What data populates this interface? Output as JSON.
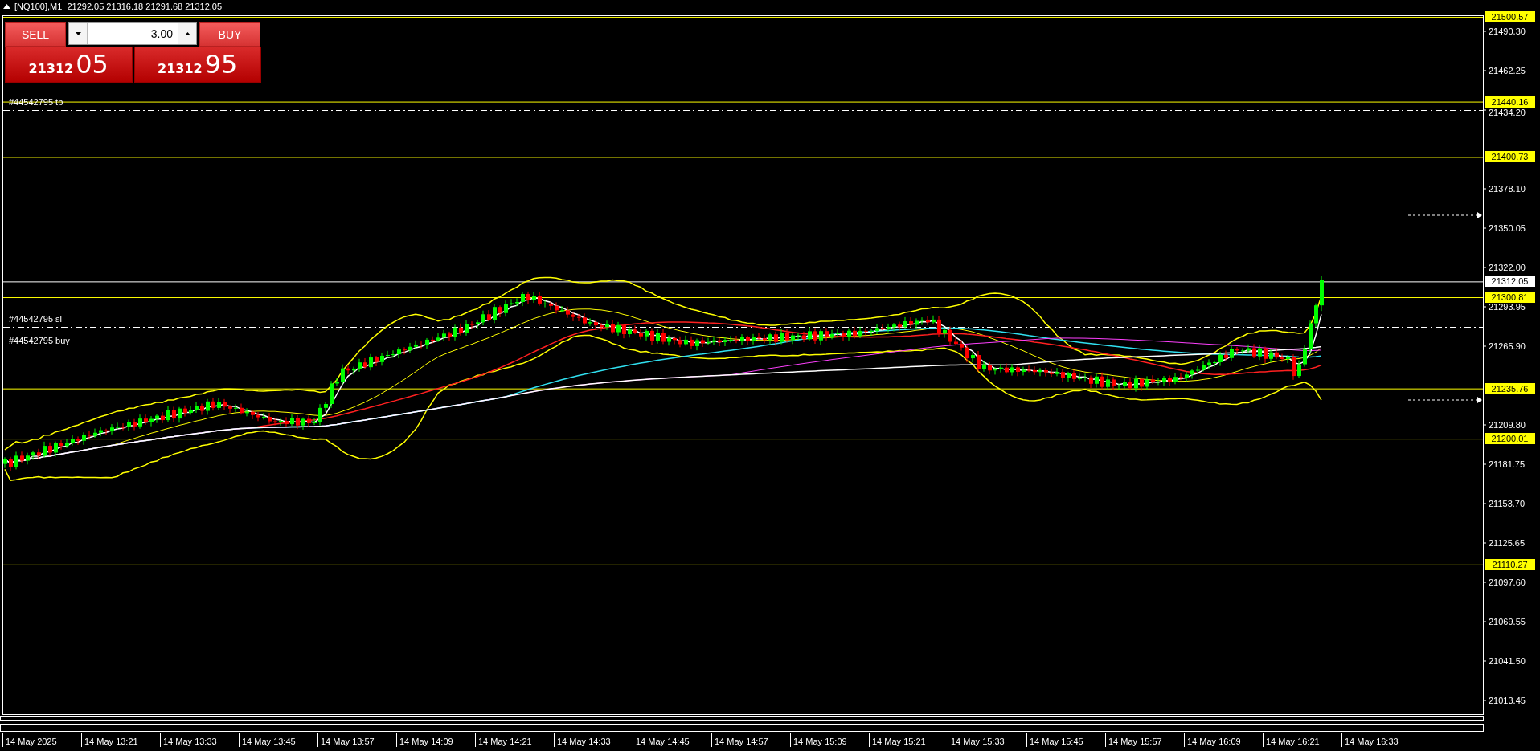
{
  "chart": {
    "title": "[NQ100],M1  21292.05 21316.18 21291.68 21312.05"
  },
  "trade_panel": {
    "sell_label": "SELL",
    "buy_label": "BUY",
    "volume": "3.00",
    "sell_price": {
      "main": "21312",
      "big": "05"
    },
    "buy_price": {
      "main": "21312",
      "big": "95"
    }
  },
  "orders": [
    {
      "label": "#44542795 tp",
      "kind": "tp"
    },
    {
      "label": "#44542795 sl",
      "kind": "sl"
    },
    {
      "label": "#44542795 buy",
      "kind": "buy"
    }
  ],
  "price_levels": [
    {
      "label": "21500.57",
      "kind": "level"
    },
    {
      "label": "21440.16",
      "kind": "level"
    },
    {
      "label": "21400.73",
      "kind": "level"
    },
    {
      "label": "21312.05",
      "kind": "bid"
    },
    {
      "label": "21300.81",
      "kind": "level"
    },
    {
      "label": "21235.76",
      "kind": "level"
    },
    {
      "label": "21200.01",
      "kind": "level"
    },
    {
      "label": "21110.27",
      "kind": "level"
    }
  ],
  "price_axis": {
    "ticks": [
      "21490.30",
      "21462.25",
      "21434.20",
      "21378.10",
      "21350.05",
      "21322.00",
      "21293.95",
      "21265.90",
      "21209.80",
      "21181.75",
      "21153.70",
      "21125.65",
      "21097.60",
      "21069.55",
      "21041.50",
      "21013.45"
    ]
  },
  "time_axis": {
    "labels": [
      "14 May 2025",
      "14 May 13:21",
      "14 May 13:33",
      "14 May 13:45",
      "14 May 13:57",
      "14 May 14:09",
      "14 May 14:21",
      "14 May 14:33",
      "14 May 14:45",
      "14 May 14:57",
      "14 May 15:09",
      "14 May 15:21",
      "14 May 15:33",
      "14 May 15:45",
      "14 May 15:57",
      "14 May 16:09",
      "14 May 16:21",
      "14 May 16:33"
    ]
  }
}
